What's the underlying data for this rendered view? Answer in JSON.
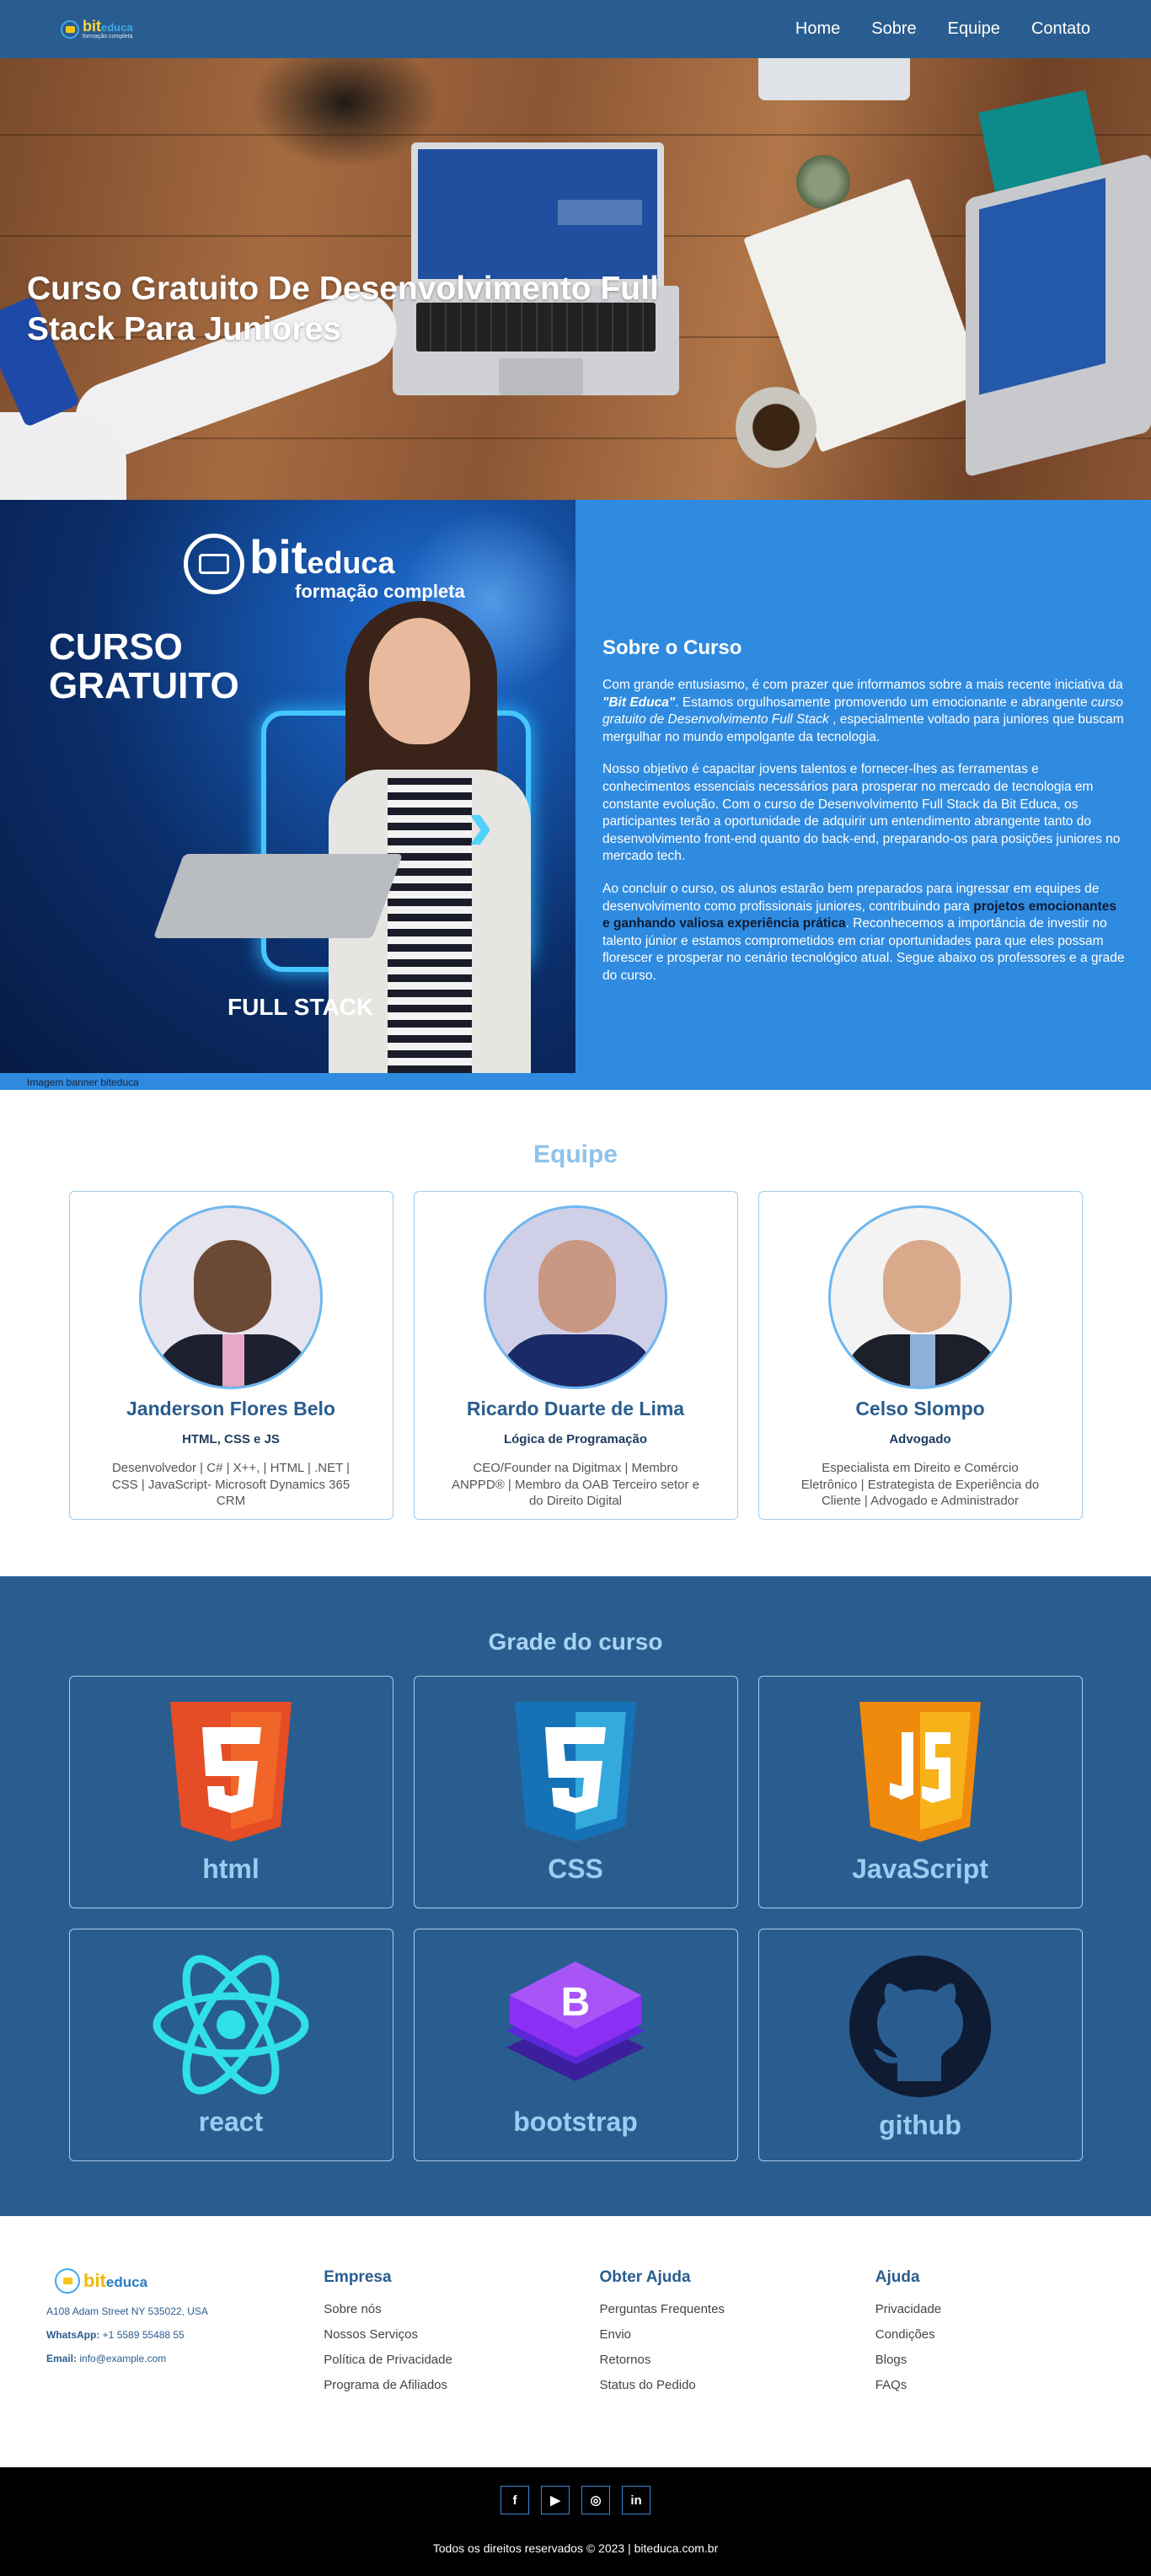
{
  "nav": {
    "logo": {
      "brand": "bit",
      "brand_suffix": "educa",
      "tagline": "formação completa"
    },
    "links": [
      "Home",
      "Sobre",
      "Equipe",
      "Contato"
    ]
  },
  "hero": {
    "title": "Curso Gratuito De Desenvolvimento Full Stack Para Juniores"
  },
  "banner": {
    "brand": "bit",
    "brand_suffix": "educa",
    "tagline": "formação completa",
    "headline": "CURSO GRATUITO",
    "footer_text": "FULL STACK",
    "caption": "Imagem banner biteduca"
  },
  "about": {
    "title": "Sobre o Curso",
    "p1_a": "Com grande entusiasmo, é com prazer que informamos sobre a mais recente iniciativa da ",
    "p1_b": "\"Bit Educa\"",
    "p1_c": ". Estamos orgulhosamente promovendo um emocionante e abrangente ",
    "p1_d": "curso gratuito de Desenvolvimento Full Stack",
    "p1_e": " , especialmente voltado para juniores que buscam mergulhar no mundo empolgante da tecnologia.",
    "p2": "Nosso objetivo é capacitar jovens talentos e fornecer-lhes as ferramentas e conhecimentos essenciais necessários para prosperar no mercado de tecnologia em constante evolução. Com o curso de Desenvolvimento Full Stack da Bit Educa, os participantes terão a oportunidade de adquirir um entendimento abrangente tanto do desenvolvimento front-end quanto do back-end, preparando-os para posições juniores no mercado tech.",
    "p3_a": "Ao concluir o curso, os alunos estarão bem preparados para ingressar em equipes de desenvolvimento como profissionais juniores, contribuindo para ",
    "p3_b": "projetos emocionantes e ganhando valiosa experiência prática",
    "p3_c": ". Reconhecemos a importância de investir no talento júnior e estamos comprometidos em criar oportunidades para que eles possam florescer e prosperar no cenário tecnológico atual. Segue abaixo os professores e a grade do curso."
  },
  "team": {
    "title": "Equipe",
    "members": [
      {
        "name": "Janderson Flores Belo",
        "role": "HTML, CSS e JS",
        "desc": "Desenvolvedor | C# | X++, | HTML | .NET | CSS | JavaScript- Microsoft Dynamics 365 CRM",
        "skin": "#6b4a35"
      },
      {
        "name": "Ricardo Duarte de Lima",
        "role": "Lógica de Programação",
        "desc": "CEO/Founder na Digitmax | Membro ANPPD® | Membro da OAB Terceiro setor e do Direito Digital",
        "skin": "#c99882"
      },
      {
        "name": "Celso Slompo",
        "role": "Advogado",
        "desc": "Especialista em Direito e Comércio Eletrônico | Estrategista de Experiência do Cliente | Advogado e Administrador",
        "skin": "#d9a98c"
      }
    ]
  },
  "grade": {
    "title": "Grade do curso",
    "items": [
      {
        "label": "html",
        "icon": "html5-icon"
      },
      {
        "label": "CSS",
        "icon": "css3-icon"
      },
      {
        "label": "JavaScript",
        "icon": "js-icon"
      },
      {
        "label": "react",
        "icon": "react-icon"
      },
      {
        "label": "bootstrap",
        "icon": "bootstrap-icon"
      },
      {
        "label": "github",
        "icon": "github-icon"
      }
    ]
  },
  "footer": {
    "address": "A108 Adam Street NY 535022, USA",
    "whatsapp_label": "WhatsApp:",
    "whatsapp": "+1 5589 55488 55",
    "email_label": "Email:",
    "email": "info@example.com",
    "columns": [
      {
        "title": "Empresa",
        "links": [
          "Sobre nós",
          "Nossos Serviços",
          "Política de Privacidade",
          "Programa de Afiliados"
        ]
      },
      {
        "title": "Obter Ajuda",
        "links": [
          "Perguntas Frequentes",
          "Envio",
          "Retornos",
          "Status do Pedido"
        ]
      },
      {
        "title": "Ajuda",
        "links": [
          "Privacidade",
          "Condições",
          "Blogs",
          "FAQs"
        ]
      }
    ]
  },
  "bottom": {
    "socials": [
      {
        "glyph": "f",
        "icon": "facebook-icon"
      },
      {
        "glyph": "▶",
        "icon": "youtube-icon"
      },
      {
        "glyph": "◎",
        "icon": "instagram-icon"
      },
      {
        "glyph": "in",
        "icon": "linkedin-icon"
      }
    ],
    "copyright": "Todos os direitos reservados © 2023 | biteduca.com.br"
  },
  "colors": {
    "nav": "#2a5d8f",
    "about_bg": "#2f8be0",
    "accent": "#8ec2ea"
  }
}
